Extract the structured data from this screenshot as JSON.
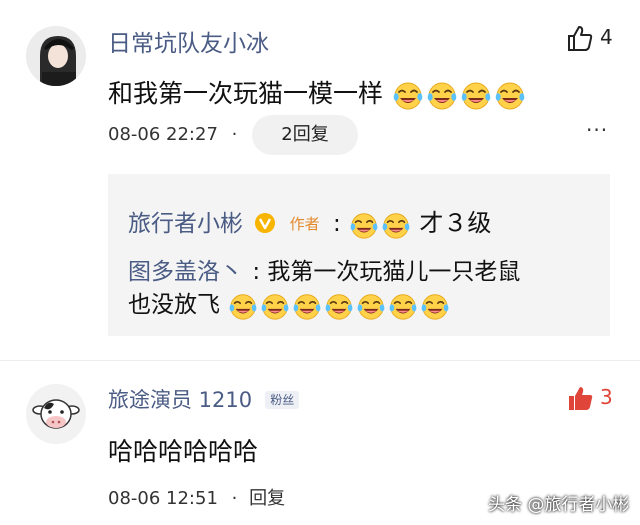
{
  "comment1": {
    "username": "日常坑队友小冰",
    "like_count": "4",
    "text": "和我第一次玩猫一模一样",
    "emoji_count": 4,
    "date": "08-06 22:27",
    "dot": "·",
    "reply_button": "2回复",
    "more": "···"
  },
  "sub_replies": {
    "author_name": "旅行者小彬",
    "author_tag": "作者",
    "author_colon": ":",
    "author_text": "才３级",
    "reply2_name": "图多盖洛丶",
    "reply2_colon": ":",
    "reply2_line1": "我第一次玩猫儿一只老鼠",
    "reply2_line2": "也没放飞"
  },
  "comment2": {
    "username": "旅途演员 1210",
    "fan_badge": "粉丝",
    "like_count": "3",
    "text": "哈哈哈哈哈哈",
    "date": "08-06 12:51",
    "dot": "·",
    "reply_link": "回复"
  },
  "watermark": "头条 @旅行者小彬",
  "colors": {
    "username": "#4a5b84",
    "like_active": "#e0453a",
    "author_tag": "#e38b2c",
    "sub_box_bg": "#f4f4f4"
  },
  "icons": [
    "thumbs-up-icon",
    "more-icon",
    "verified-v-icon",
    "crying-laughing-emoji",
    "cow-avatar"
  ]
}
